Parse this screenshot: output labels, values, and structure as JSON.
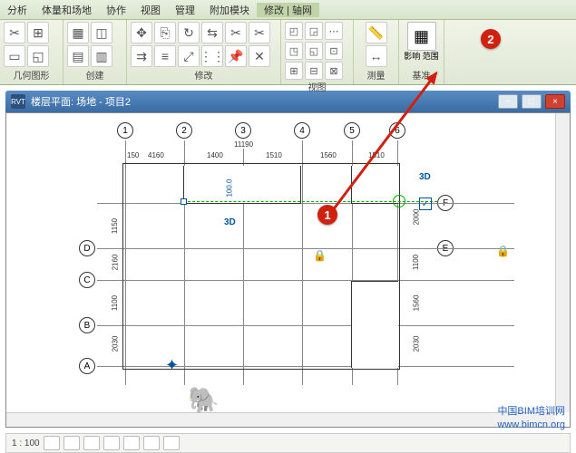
{
  "menu": {
    "items": [
      "分析",
      "体量和场地",
      "协作",
      "视图",
      "管理",
      "附加模块",
      "修改 | 轴网"
    ]
  },
  "ribbon": {
    "groups": [
      {
        "label": "几何图形"
      },
      {
        "label": "创建"
      },
      {
        "label": "修改"
      },
      {
        "label": "视图"
      },
      {
        "label": "测量"
      },
      {
        "label": "基准",
        "big_label": "影响\n范围"
      }
    ]
  },
  "viewport": {
    "title": "楼层平面: 场地 - 项目2"
  },
  "grids": {
    "vertical": [
      "1",
      "2",
      "3",
      "4",
      "5",
      "6"
    ],
    "horizontal": [
      "A",
      "B",
      "C",
      "D",
      "E",
      "F"
    ]
  },
  "dimensions": {
    "top_total": "11190",
    "top": [
      "150",
      "4160",
      "1400",
      "1510",
      "1560",
      "1510"
    ],
    "left": [
      "2030",
      "1100",
      "2160",
      "1150"
    ],
    "right": [
      "2000",
      "1100",
      "1560",
      "2030"
    ],
    "vert_100": "100.0"
  },
  "markers": {
    "d3": "3D",
    "d3_right": "3D"
  },
  "callouts": {
    "c1": "1",
    "c2": "2"
  },
  "statusbar": {
    "scale": "1 : 100"
  },
  "watermark": {
    "line1": "中国BIM培训网",
    "line2": "www.bimcn.org"
  }
}
